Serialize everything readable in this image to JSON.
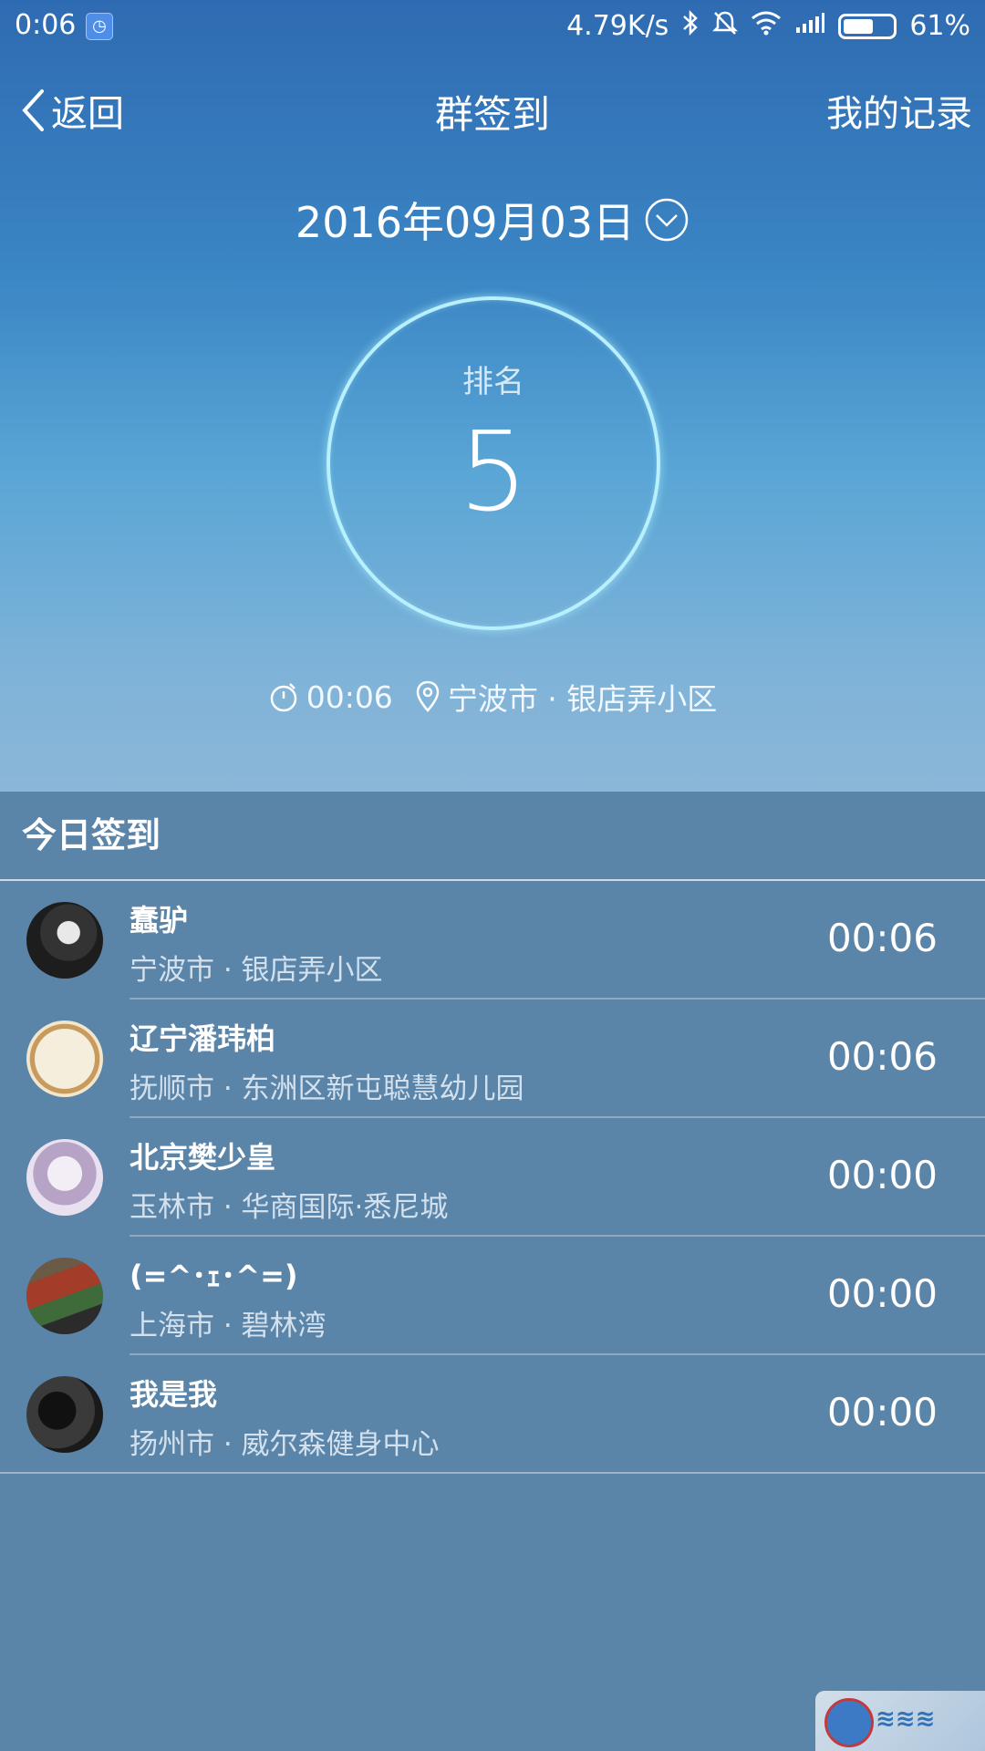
{
  "status_bar": {
    "time": "0:06",
    "speed": "4.79K/s",
    "battery_pct": "61%",
    "battery_level": 0.61,
    "icons": [
      "app-icon",
      "bluetooth-icon",
      "silent-bell-icon",
      "wifi-icon",
      "signal-icon",
      "battery-icon"
    ]
  },
  "header": {
    "back_label": "返回",
    "title": "群签到",
    "right_action": "我的记录"
  },
  "date": {
    "label": "2016年09月03日"
  },
  "rank": {
    "label": "排名",
    "value": "5"
  },
  "checkin_info": {
    "time": "00:06",
    "location": "宁波市 · 银店弄小区"
  },
  "list": {
    "heading": "今日签到",
    "items": [
      {
        "name": "蠢驴",
        "location": "宁波市 · 银店弄小区",
        "time": "00:06"
      },
      {
        "name": "辽宁潘玮柏",
        "location": "抚顺市 · 东洲区新屯聪慧幼儿园",
        "time": "00:06"
      },
      {
        "name": "北京樊少皇",
        "location": "玉林市 · 华商国际·悉尼城",
        "time": "00:00"
      },
      {
        "name": "(=^･ｪ･^=)",
        "location": "上海市 · 碧林湾",
        "time": "00:00"
      },
      {
        "name": "我是我",
        "location": "扬州市 · 威尔森健身中心",
        "time": "00:00"
      }
    ]
  },
  "colors": {
    "hero_top": "#2f6bb2",
    "hero_bottom": "#8bb7d8",
    "list_bg": "#5a84a8",
    "circle_ring": "#b8f0ff"
  }
}
